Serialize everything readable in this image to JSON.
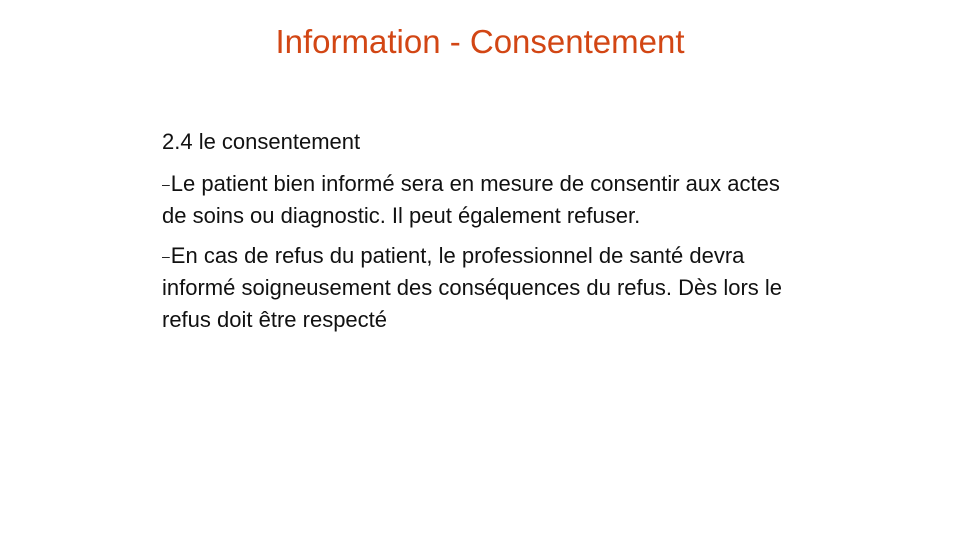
{
  "slide": {
    "title": "Information - Consentement",
    "section_heading": "2.4 le consentement",
    "bullets": [
      {
        "marker": "–",
        "text": "Le patient bien informé sera en mesure de consentir aux actes de soins ou diagnostic. Il peut également refuser."
      },
      {
        "marker": "–",
        "text": "En cas de refus du patient, le professionnel de santé devra informé soigneusement des conséquences du refus. Dès lors le refus doit être respecté"
      }
    ]
  },
  "colors": {
    "title": "#d24614",
    "text": "#111111",
    "background": "#ffffff"
  }
}
